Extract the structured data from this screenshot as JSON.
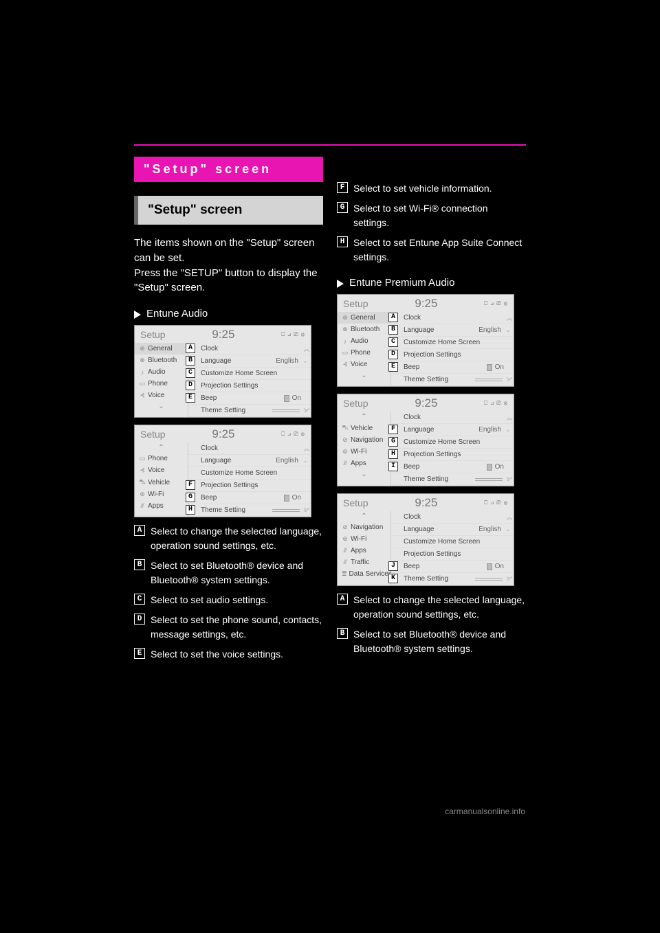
{
  "page": {
    "rule_color": "#e815b3"
  },
  "title_bar": "\"Setup\" screen",
  "sub_header": "\"Setup\" screen",
  "intro": "The items shown on the \"Setup\" screen can be set.\nPress the \"SETUP\" button to display the \"Setup\" screen.",
  "left_subtype": "Entune Audio",
  "right_subtype": "Entune Premium Audio",
  "shot_common": {
    "setup_label": "Setup",
    "time": "9:25",
    "icons": "⎕ ⊿ ⎚ ⊗",
    "rows": {
      "clock": "Clock",
      "language": "Language",
      "language_val": "English",
      "customize": "Customize Home Screen",
      "projection": "Projection Settings",
      "beep": "Beep",
      "beep_val": "On",
      "theme": "Theme Setting"
    }
  },
  "left_shots": {
    "s1": {
      "side": [
        {
          "ico": "⊕",
          "t": "General",
          "sel": true
        },
        {
          "ico": "⊗",
          "t": "Bluetooth"
        },
        {
          "ico": "♪",
          "t": "Audio"
        },
        {
          "ico": "▭",
          "t": "Phone"
        },
        {
          "ico": "⊰",
          "t": "Voice"
        }
      ],
      "boxes": [
        "A",
        "B",
        "C",
        "D",
        "E"
      ],
      "last_row": "theme"
    },
    "s2": {
      "side": [
        {
          "ico": "▭",
          "t": "Phone"
        },
        {
          "ico": "⊰",
          "t": "Voice"
        },
        {
          "ico": "⛍",
          "t": "Vehicle"
        },
        {
          "ico": "⊚",
          "t": "Wi-Fi"
        },
        {
          "ico": "⫻",
          "t": "Apps"
        }
      ],
      "boxes": [
        "F",
        "G",
        "H"
      ],
      "box_rows": [
        "projection",
        "beep",
        "theme"
      ],
      "show_up_caret": true
    }
  },
  "right_shots": {
    "s1": {
      "side": [
        {
          "ico": "⊕",
          "t": "General",
          "sel": true
        },
        {
          "ico": "⊗",
          "t": "Bluetooth"
        },
        {
          "ico": "♪",
          "t": "Audio"
        },
        {
          "ico": "▭",
          "t": "Phone"
        },
        {
          "ico": "⊰",
          "t": "Voice"
        }
      ],
      "boxes": [
        "A",
        "B",
        "C",
        "D",
        "E"
      ],
      "last_row": "theme"
    },
    "s2": {
      "side": [
        {
          "ico": "⛍",
          "t": "Vehicle"
        },
        {
          "ico": "⊘",
          "t": "Navigation"
        },
        {
          "ico": "⊚",
          "t": "Wi-Fi"
        },
        {
          "ico": "⫻",
          "t": "Apps"
        }
      ],
      "boxes": [
        "F",
        "G",
        "H",
        "I"
      ],
      "box_rows": [
        "language",
        "customize",
        "projection",
        "beep"
      ],
      "show_up_caret": true,
      "first_row": "clock",
      "last_row": "theme"
    },
    "s3": {
      "side": [
        {
          "ico": "⊘",
          "t": "Navigation"
        },
        {
          "ico": "⊚",
          "t": "Wi-Fi"
        },
        {
          "ico": "⫻",
          "t": "Apps"
        },
        {
          "ico": "⫻",
          "t": "Traffic"
        },
        {
          "ico": "≣",
          "t": "Data Services"
        }
      ],
      "boxes": [
        "J",
        "K"
      ],
      "box_rows": [
        "beep",
        "theme"
      ],
      "show_up_caret": true
    }
  },
  "desc_left": {
    "A": "Select to change the selected language, operation sound settings, etc.",
    "B": "Select to set Bluetooth® device and Bluetooth® system settings.",
    "C": "Select to set audio settings.",
    "D": "Select to set the phone sound, contacts, message settings, etc.",
    "E": "Select to set the voice settings."
  },
  "desc_right_top": {
    "F": "Select to set vehicle information.",
    "G": "Select to set Wi-Fi® connection settings.",
    "H": "Select to set Entune App Suite Connect settings."
  },
  "desc_right_bottom": {
    "A": "Select to change the selected language, operation sound settings, etc.",
    "B": "Select to set Bluetooth® device and Bluetooth® system settings."
  },
  "footer": "carmanualsonline.info"
}
